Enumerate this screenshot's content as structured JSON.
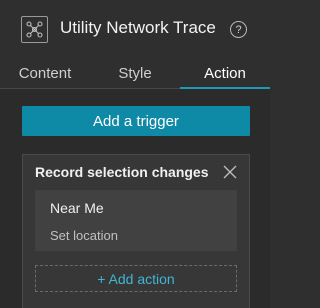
{
  "header": {
    "title": "Utility Network Trace",
    "widget_icon": "network-nodes-icon",
    "help_icon": "help-circle-icon",
    "help_glyph": "?"
  },
  "tabs": [
    {
      "label": "Content",
      "active": false
    },
    {
      "label": "Style",
      "active": false
    },
    {
      "label": "Action",
      "active": true
    }
  ],
  "main": {
    "add_trigger_label": "Add a trigger",
    "trigger_card": {
      "title": "Record selection changes",
      "close_icon": "close-icon",
      "actions": [
        {
          "name": "Near Me",
          "subtitle": "Set location"
        }
      ],
      "add_action_label": "+ Add action"
    }
  },
  "colors": {
    "accent": "#1d9ab6",
    "button": "#0f8aa6",
    "link": "#3fb6d3",
    "background": "#2f2f2f"
  }
}
